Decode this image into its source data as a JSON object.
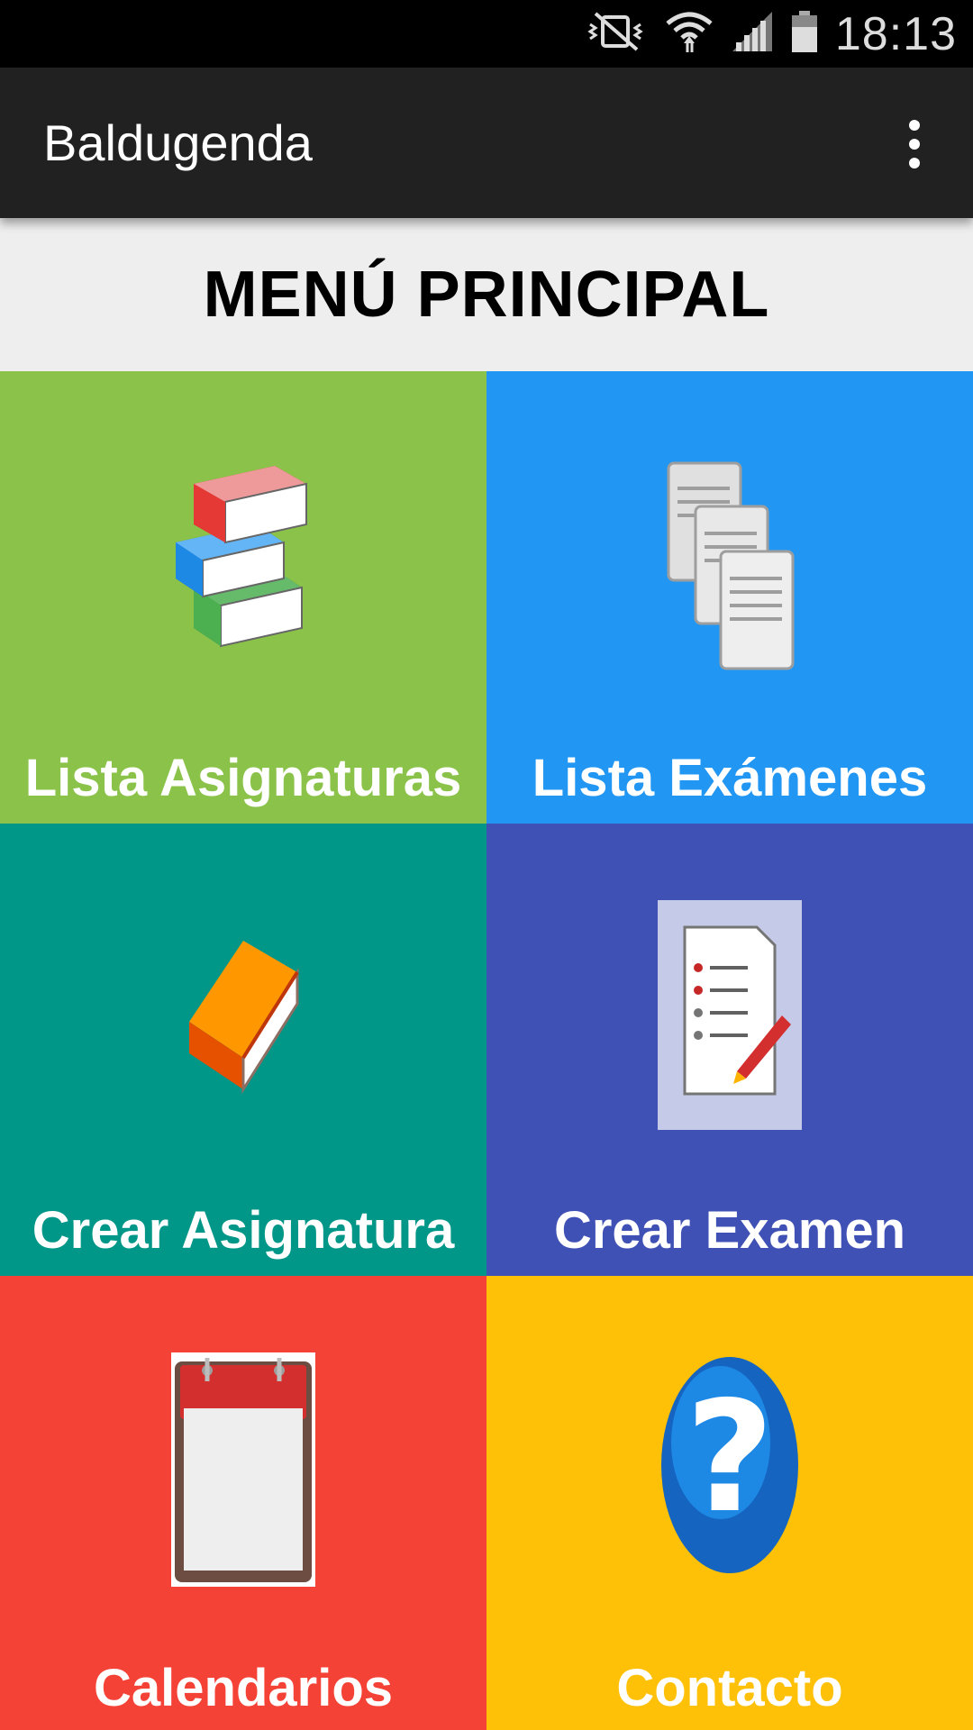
{
  "status_bar": {
    "time": "18:13",
    "icons": [
      "vibrate-icon",
      "wifi-icon",
      "signal-icon",
      "battery-icon"
    ]
  },
  "app_bar": {
    "title": "Baldugenda",
    "overflow_icon": "more-vert-icon"
  },
  "header": {
    "title": "MENÚ PRINCIPAL"
  },
  "tiles": [
    {
      "label": "Lista Asignaturas",
      "color": "#8BC34A",
      "icon": "books-stack-icon"
    },
    {
      "label": "Lista Exámenes",
      "color": "#2196F3",
      "icon": "documents-icon"
    },
    {
      "label": "Crear Asignatura",
      "color": "#009688",
      "icon": "book-icon"
    },
    {
      "label": "Crear Examen",
      "color": "#3F51B5",
      "icon": "exam-checklist-icon"
    },
    {
      "label": "Calendarios",
      "color": "#F44336",
      "icon": "calendar-icon"
    },
    {
      "label": "Contacto",
      "color": "#FFC107",
      "icon": "help-icon"
    }
  ]
}
